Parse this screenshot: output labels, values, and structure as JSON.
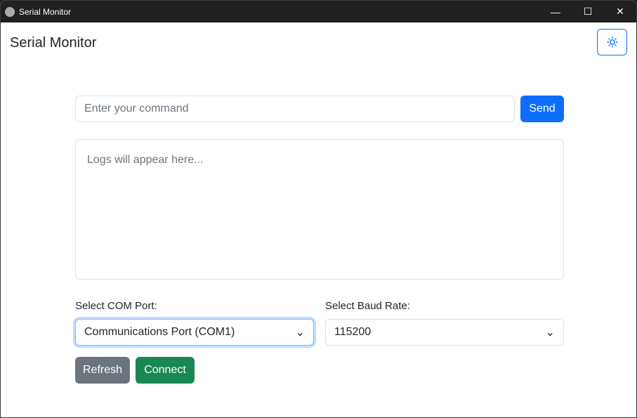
{
  "window": {
    "title": "Serial Monitor",
    "minimize": "—",
    "maximize": "☐",
    "close": "✕"
  },
  "header": {
    "title": "Serial Monitor",
    "theme_icon": "sun-icon"
  },
  "command": {
    "placeholder": "Enter your command",
    "send_label": "Send"
  },
  "logs": {
    "placeholder": "Logs will appear here..."
  },
  "com": {
    "label": "Select COM Port:",
    "value": "Communications Port (COM1)"
  },
  "baud": {
    "label": "Select Baud Rate:",
    "value": "115200"
  },
  "buttons": {
    "refresh": "Refresh",
    "connect": "Connect"
  },
  "colors": {
    "primary": "#0d6efd",
    "secondary": "#6c757d",
    "success": "#198754"
  }
}
